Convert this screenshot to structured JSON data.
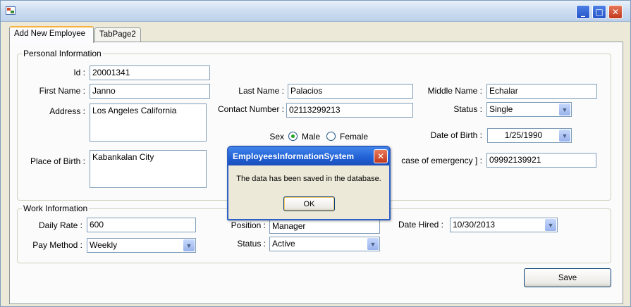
{
  "tabs": [
    {
      "label": "Add New Employee",
      "active": true
    },
    {
      "label": "TabPage2",
      "active": false
    }
  ],
  "personal": {
    "title": "Personal Information",
    "id": {
      "label": "Id :",
      "value": "20001341"
    },
    "first_name": {
      "label": "First Name :",
      "value": "Janno"
    },
    "last_name": {
      "label": "Last Name :",
      "value": "Palacios"
    },
    "middle_name": {
      "label": "Middle Name :",
      "value": "Echalar"
    },
    "address": {
      "label": "Address :",
      "value": "Los Angeles California"
    },
    "contact_number": {
      "label": "Contact Number :",
      "value": "02113299213"
    },
    "status": {
      "label": "Status :",
      "value": "Single"
    },
    "sex": {
      "label": "Sex",
      "male": "Male",
      "female": "Female",
      "selected": "Male"
    },
    "date_of_birth": {
      "label": "Date of Birth :",
      "value": "1/25/1990"
    },
    "place_of_birth": {
      "label": "Place of Birth :",
      "value": "Kabankalan City"
    },
    "emergency": {
      "label": "case of emergency ] :",
      "value": "09992139921"
    }
  },
  "work": {
    "title": "Work Information",
    "daily_rate": {
      "label": "Daily Rate :",
      "value": "600"
    },
    "position": {
      "label": "Position :",
      "value": "Manager"
    },
    "date_hired": {
      "label": "Date Hired :",
      "value": "10/30/2013"
    },
    "pay_method": {
      "label": "Pay Method :",
      "value": "Weekly"
    },
    "status": {
      "label": "Status :",
      "value": "Active"
    }
  },
  "save_label": "Save",
  "dialog": {
    "title": "EmployeesInformationSystem",
    "message": "The data has been saved in the database.",
    "ok_label": "OK"
  }
}
